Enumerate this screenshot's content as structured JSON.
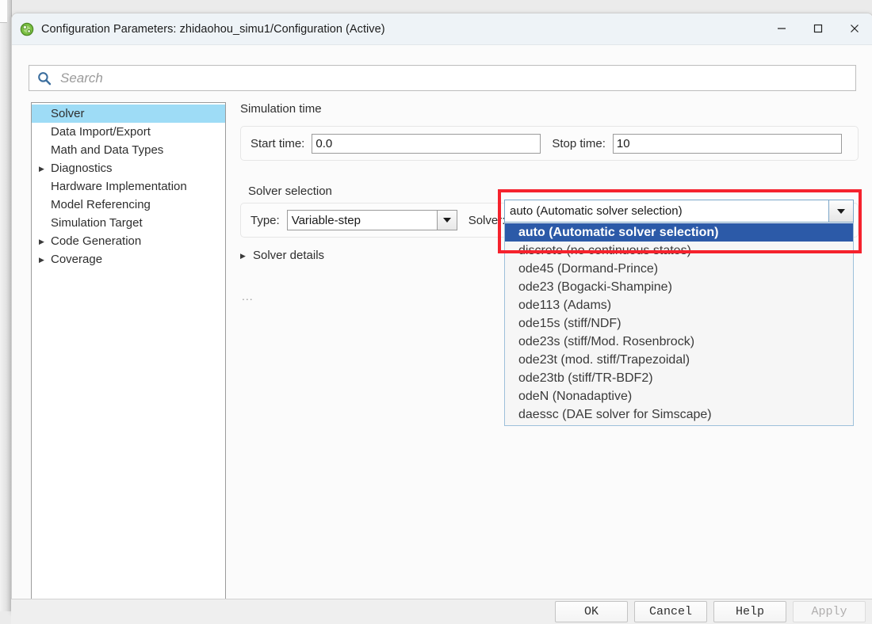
{
  "window": {
    "title": "Configuration Parameters: zhidaohou_simu1/Configuration (Active)",
    "app_icon": "simulink-icon",
    "minimize_label": "—",
    "maximize_label": "☐",
    "close_label": "✕"
  },
  "search": {
    "placeholder": "Search",
    "value": "",
    "icon": "search-icon"
  },
  "sidebar": {
    "items": [
      {
        "label": "Solver",
        "selected": true,
        "expandable": false
      },
      {
        "label": "Data Import/Export",
        "selected": false,
        "expandable": false
      },
      {
        "label": "Math and Data Types",
        "selected": false,
        "expandable": false
      },
      {
        "label": "Diagnostics",
        "selected": false,
        "expandable": true
      },
      {
        "label": "Hardware Implementation",
        "selected": false,
        "expandable": false
      },
      {
        "label": "Model Referencing",
        "selected": false,
        "expandable": false
      },
      {
        "label": "Simulation Target",
        "selected": false,
        "expandable": false
      },
      {
        "label": "Code Generation",
        "selected": false,
        "expandable": true
      },
      {
        "label": "Coverage",
        "selected": false,
        "expandable": true
      }
    ]
  },
  "main": {
    "simulation_time": {
      "group_title": "Simulation time",
      "start_time_label": "Start time:",
      "start_time_value": "0.0",
      "stop_time_label": "Stop time:",
      "stop_time_value": "10"
    },
    "solver_selection": {
      "group_title": "Solver selection",
      "type_label": "Type:",
      "type_value": "Variable-step",
      "solver_label": "Solver:",
      "solver_value": "auto (Automatic solver selection)",
      "dropdown_open": true,
      "options": [
        {
          "label": "auto (Automatic solver selection)",
          "highlighted": true
        },
        {
          "label": "discrete (no continuous states)",
          "highlighted": false
        },
        {
          "label": "ode45 (Dormand-Prince)",
          "highlighted": false
        },
        {
          "label": "ode23 (Bogacki-Shampine)",
          "highlighted": false
        },
        {
          "label": "ode113 (Adams)",
          "highlighted": false
        },
        {
          "label": "ode15s (stiff/NDF)",
          "highlighted": false
        },
        {
          "label": "ode23s (stiff/Mod. Rosenbrock)",
          "highlighted": false
        },
        {
          "label": "ode23t (mod. stiff/Trapezoidal)",
          "highlighted": false
        },
        {
          "label": "ode23tb (stiff/TR-BDF2)",
          "highlighted": false
        },
        {
          "label": "odeN (Nonadaptive)",
          "highlighted": false
        },
        {
          "label": "daessc (DAE solver for Simscape)",
          "highlighted": false
        }
      ]
    },
    "solver_details_label": "Solver details",
    "ellipsis": "..."
  },
  "annotation": {
    "highlight_color": "#f5222d"
  },
  "footer": {
    "ok_label": "OK",
    "cancel_label": "Cancel",
    "help_label": "Help",
    "apply_label": "Apply",
    "apply_disabled": true
  },
  "colors": {
    "selection_blue": "#9edcf6",
    "dropdown_highlight": "#2c5aa8",
    "titlebar": "#eef3f7",
    "search_icon_blue": "#3b6e9e"
  }
}
